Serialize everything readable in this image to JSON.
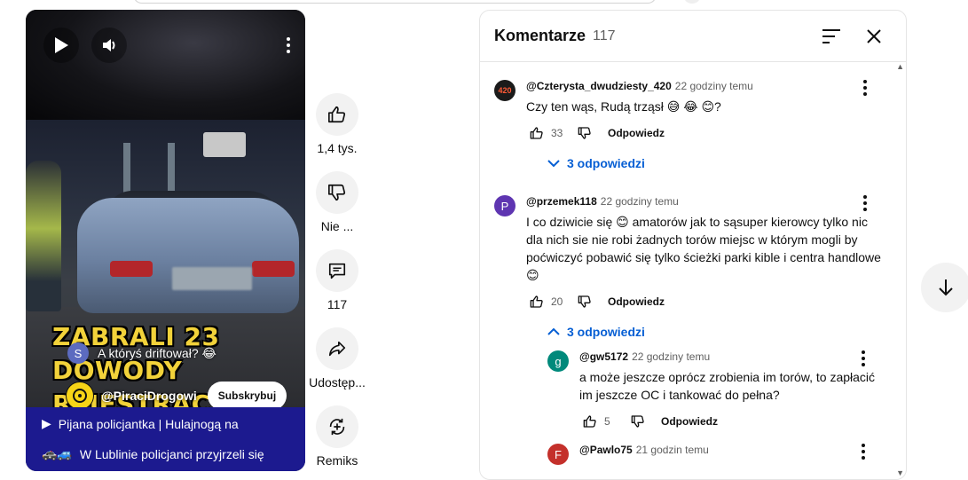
{
  "video": {
    "caption_line1": "ZABRALI 23 DOWODY",
    "caption_line2": "REJESTRACYJNE",
    "poll": {
      "avatar_letter": "S",
      "text": "A któryś driftował? 😂"
    },
    "channel": {
      "name": "@PiraciDrogowi",
      "subscribe_label": "Subskrybuj"
    },
    "playlist": [
      {
        "prefix": "▶",
        "title": "Pijana policjantka | Hulajnogą na"
      },
      {
        "prefix": "🚓🚙",
        "title": "W Lublinie policjanci przyjrzeli się"
      }
    ]
  },
  "actions": {
    "like_count": "1,4 tys.",
    "dislike_label": "Nie ...",
    "comments_count": "117",
    "share_label": "Udostęp...",
    "remix_label": "Remiks"
  },
  "comments_panel": {
    "title": "Komentarze",
    "count": "117",
    "comments": [
      {
        "author": "@Czterysta_dwudziesty_420",
        "time": "22 godziny temu",
        "avatar": "420",
        "text": "Czy ten wąs, Rudą trząsł 😅 😂 😊?",
        "likes": "33",
        "reply_label": "Odpowiedz",
        "replies_toggle": "3 odpowiedzi"
      },
      {
        "author": "@przemek118",
        "time": "22 godziny temu",
        "avatar": "P",
        "text": "I co dziwicie się 😊 amatorów jak to sąsuper kierowcy tylko nic dla nich sie nie robi żadnych torów miejsc w którym mogli by poćwiczyć pobawić się tylko ścieżki parki kible i centra handlowe 😊",
        "likes": "20",
        "reply_label": "Odpowiedz",
        "replies_toggle": "3 odpowiedzi"
      }
    ],
    "replies": [
      {
        "author": "@gw5172",
        "time": "22 godziny temu",
        "avatar": "g",
        "text": "a może jeszcze oprócz zrobienia im torów, to zapłacić im jeszcze OC i tankować do pełna?",
        "likes": "5",
        "reply_label": "Odpowiedz"
      },
      {
        "author": "@Pawlo75",
        "time": "21 godzin temu",
        "avatar": "F"
      }
    ]
  },
  "colors": {
    "accent_blue": "#065fd4",
    "avatar_purple": "#5e35b1",
    "avatar_teal": "#00897b",
    "avatar_red": "#c4302b",
    "playlist_bg": "#1c1a8f"
  }
}
